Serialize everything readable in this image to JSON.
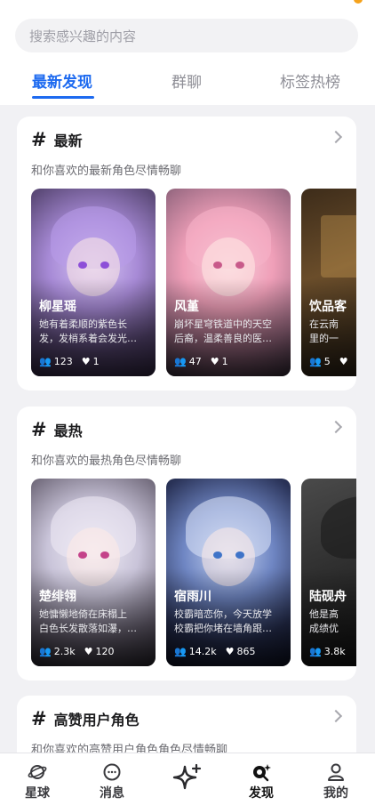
{
  "search": {
    "placeholder": "搜索感兴趣的内容"
  },
  "tabs": [
    {
      "label": "最新发现",
      "active": true
    },
    {
      "label": "群聊",
      "active": false
    },
    {
      "label": "标签热榜",
      "active": false
    }
  ],
  "sections": [
    {
      "title": "最新",
      "subtitle": "和你喜欢的最新角色尽情畅聊",
      "characters": [
        {
          "name": "柳星瑶",
          "desc_line1": "她有着柔顺的紫色长",
          "desc_line2": "发，发梢系着会发光…",
          "chats": "123",
          "likes": "1",
          "theme": "purple"
        },
        {
          "name": "风堇",
          "desc_line1": "崩坏星穹铁道中的天空",
          "desc_line2": "后裔，温柔善良的医…",
          "chats": "47",
          "likes": "1",
          "theme": "pink"
        },
        {
          "name": "饮品客",
          "desc_line1": "在云南",
          "desc_line2": "里的一",
          "chats": "5",
          "likes": "",
          "theme": "shop"
        }
      ]
    },
    {
      "title": "最热",
      "subtitle": "和你喜欢的最热角色尽情畅聊",
      "characters": [
        {
          "name": "楚绯翎",
          "desc_line1": "她慵懒地倚在床榻上",
          "desc_line2": "白色长发散落如瀑，…",
          "chats": "2.3k",
          "likes": "120",
          "theme": "silver"
        },
        {
          "name": "宿雨川",
          "desc_line1": "校霸暗恋你，今天放学",
          "desc_line2": "校霸把你堵在墙角跟…",
          "chats": "14.2k",
          "likes": "865",
          "theme": "blue"
        },
        {
          "name": "陆砚舟",
          "desc_line1": "他是高",
          "desc_line2": "成绩优",
          "chats": "3.8k",
          "likes": "",
          "theme": "dark"
        }
      ]
    },
    {
      "title": "高赞用户角色",
      "subtitle": "和你喜欢的高赞用户角色角色尽情畅聊"
    }
  ],
  "bottom_nav": [
    {
      "label": "星球",
      "icon": "planet-icon"
    },
    {
      "label": "消息",
      "icon": "message-icon"
    },
    {
      "label": "",
      "icon": "sparkle-icon"
    },
    {
      "label": "发现",
      "icon": "discover-icon",
      "active": true
    },
    {
      "label": "我的",
      "icon": "profile-icon"
    }
  ],
  "colors": {
    "accent": "#1d6af0",
    "background": "#f1f1f4"
  }
}
